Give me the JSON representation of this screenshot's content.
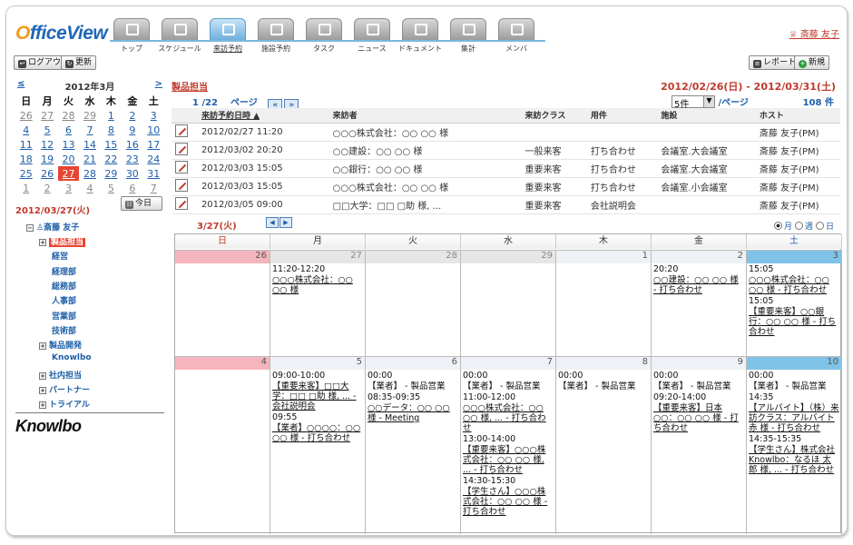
{
  "app": {
    "name": "OfficeView"
  },
  "tabs": [
    {
      "label": "トップ",
      "icon": "search-icon"
    },
    {
      "label": "スケジュール",
      "icon": "calendar-icon"
    },
    {
      "label": "来訪予約",
      "icon": "bag-icon"
    },
    {
      "label": "施設予約",
      "icon": "building-icon"
    },
    {
      "label": "タスク",
      "icon": "checklist-icon"
    },
    {
      "label": "ニュース",
      "icon": "news-icon"
    },
    {
      "label": "ドキュメント",
      "icon": "document-icon"
    },
    {
      "label": "集計",
      "icon": "chart-icon"
    },
    {
      "label": "メンバ",
      "icon": "members-icon"
    }
  ],
  "user": {
    "name": "斎藤 友子"
  },
  "toolbar": {
    "logout": "ログアウト",
    "refresh": "更新",
    "report": "レポート",
    "new": "新規"
  },
  "mini_calendar": {
    "prev": "≤",
    "month": "2012年3月",
    "next": ">",
    "dow": [
      "日",
      "月",
      "火",
      "水",
      "木",
      "金",
      "土"
    ],
    "weeks": [
      [
        "26",
        "27",
        "28",
        "29",
        "1",
        "2",
        "3"
      ],
      [
        "4",
        "5",
        "6",
        "7",
        "8",
        "9",
        "10"
      ],
      [
        "11",
        "12",
        "13",
        "14",
        "15",
        "16",
        "17"
      ],
      [
        "18",
        "19",
        "20",
        "21",
        "22",
        "23",
        "24"
      ],
      [
        "25",
        "26",
        "27",
        "28",
        "29",
        "30",
        "31"
      ],
      [
        "1",
        "2",
        "3",
        "4",
        "5",
        "6",
        "7"
      ]
    ],
    "selected": "2012/03/27(火)",
    "today_button": "今日"
  },
  "tree": {
    "root": "斎藤 友子",
    "items": [
      "製品担当",
      "経営",
      "経理部",
      "総務部",
      "人事部",
      "営業部",
      "技術部",
      "製品開発",
      "Knowlbo",
      "社内担当",
      "パートナー",
      "トライアル"
    ]
  },
  "brand": "Knowlbo",
  "main": {
    "title": "製品担当",
    "range": "2012/02/26(日) - 2012/03/31(土)",
    "page": "1 /22",
    "page_label": "ページ",
    "per_page": "5件",
    "per_page_suffix": "/ページ",
    "count": "108 件"
  },
  "visits": {
    "columns": [
      "来訪予約日時 ▲",
      "来訪者",
      "来訪クラス",
      "用件",
      "施設",
      "ホスト"
    ],
    "rows": [
      [
        "2012/02/27 11:20",
        "○○○株式会社：○○ ○○ 様",
        "",
        "",
        "",
        "斎藤 友子(PM)"
      ],
      [
        "2012/03/02 20:20",
        "○○建設：○○ ○○ 様",
        "一般来客",
        "打ち合わせ",
        "会議室.大会議室",
        "斎藤 友子(PM)"
      ],
      [
        "2012/03/03 15:05",
        "○○銀行：○○ ○○ 様",
        "重要来客",
        "打ち合わせ",
        "会議室.大会議室",
        "斎藤 友子(PM)"
      ],
      [
        "2012/03/03 15:05",
        "○○○株式会社：○○ ○○ 様",
        "重要来客",
        "打ち合わせ",
        "会議室.小会議室",
        "斎藤 友子(PM)"
      ],
      [
        "2012/03/05 09:00",
        "□□大学：□□ □助 様, ...",
        "重要来客",
        "会社説明会",
        "",
        "斎藤 友子(PM)"
      ]
    ]
  },
  "calendar": {
    "current": "3/27(火)",
    "views": [
      "月",
      "週",
      "日"
    ],
    "dow": [
      "日",
      "月",
      "火",
      "水",
      "木",
      "金",
      "土"
    ],
    "week1": {
      "days": [
        "26",
        "27",
        "28",
        "29",
        "1",
        "2",
        "3"
      ],
      "events": [
        [],
        [
          {
            "t": "11:20-12:20",
            "c": "c-black"
          },
          {
            "t": "○○○株式会社：○○ ○○ 様",
            "c": "c-blue",
            "u": true
          }
        ],
        [],
        [],
        [],
        [
          {
            "t": "20:20",
            "c": "c-black"
          },
          {
            "t": "○○建設：○○ ○○ 様 - 打ち合わせ",
            "c": "c-blue",
            "u": true
          }
        ],
        [
          {
            "t": "15:05",
            "c": "c-black"
          },
          {
            "t": "○○○株式会社：○○ ○○ 様 - 打ち合わせ",
            "c": "c-blue",
            "u": true
          },
          {
            "t": "15:05",
            "c": "c-black"
          },
          {
            "t": "【重要来客】○○銀行：○○ ○○ 様 - 打ち合わせ",
            "c": "c-gold",
            "u": true
          }
        ]
      ]
    },
    "week2": {
      "days": [
        "4",
        "5",
        "6",
        "7",
        "8",
        "9",
        "10"
      ],
      "events": [
        [],
        [
          {
            "t": "09:00-10:00",
            "c": "c-black"
          },
          {
            "t": "【重要来客】□□大学：□□ □助 様, ... - 会社説明会",
            "c": "c-gold",
            "u": true
          },
          {
            "t": "09:55",
            "c": "c-black"
          },
          {
            "t": "【業者】○○○○：○○ ○○ 様 - 打ち合わせ",
            "c": "c-black",
            "u": true
          }
        ],
        [
          {
            "t": "00:00",
            "c": "c-black"
          },
          {
            "t": "【業者】 - 製品営業",
            "c": "c-black"
          },
          {
            "t": "08:35-09:35",
            "c": "c-black"
          },
          {
            "t": "○○データ：○○ ○○ 様 - Meeting",
            "c": "c-blue",
            "u": true
          }
        ],
        [
          {
            "t": "00:00",
            "c": "c-black"
          },
          {
            "t": "【業者】 - 製品営業",
            "c": "c-black"
          },
          {
            "t": "11:00-12:00",
            "c": "c-black"
          },
          {
            "t": "○○○株式会社：○○ ○○ 様, ... - 打ち合わせ",
            "c": "c-blue",
            "u": true
          },
          {
            "t": "13:00-14:00",
            "c": "c-black"
          },
          {
            "t": "【重要来客】○○○株式会社：○○ ○○ 様, ... - 打ち合わせ",
            "c": "c-gold",
            "u": true
          },
          {
            "t": "14:30-15:30",
            "c": "c-black"
          },
          {
            "t": "【学生さん】○○○株式会社：○○ ○○ 様 - 打ち合わせ",
            "c": "c-green",
            "u": true
          }
        ],
        [
          {
            "t": "00:00",
            "c": "c-black"
          },
          {
            "t": "【業者】 - 製品営業",
            "c": "c-black"
          }
        ],
        [
          {
            "t": "00:00",
            "c": "c-black"
          },
          {
            "t": "【業者】 - 製品営業",
            "c": "c-black"
          },
          {
            "t": "09:20-14:00",
            "c": "c-black"
          },
          {
            "t": "【重要来客】日本○○：○○ ○○ 様 - 打ち合わせ",
            "c": "c-gold",
            "u": true
          }
        ],
        [
          {
            "t": "00:00",
            "c": "c-black"
          },
          {
            "t": "【業者】 - 製品営業",
            "c": "c-black"
          },
          {
            "t": "14:35",
            "c": "c-black"
          },
          {
            "t": "【アルバイト】（株）来訪クラス：アルバイト 赤 様 - 打ち合わせ",
            "c": "c-red",
            "u": true
          },
          {
            "t": "14:35-15:35",
            "c": "c-black"
          },
          {
            "t": "【学生さん】株式会社Knowlbo：なるほ 太郎 様, ... - 打ち合わせ",
            "c": "c-green",
            "u": true
          }
        ]
      ]
    }
  }
}
